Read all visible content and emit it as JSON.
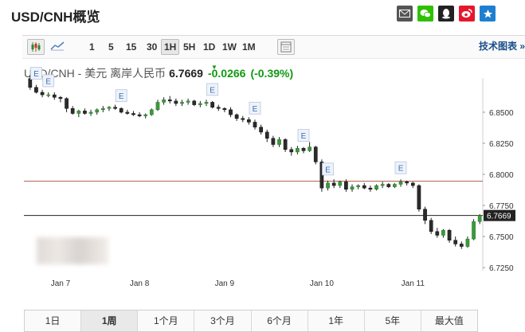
{
  "page": {
    "title": "USD/CNH概览"
  },
  "share_icons": [
    {
      "name": "email-icon",
      "color": "#555555"
    },
    {
      "name": "wechat-icon",
      "color": "#2dc100"
    },
    {
      "name": "qq-icon",
      "color": "#222222"
    },
    {
      "name": "weibo-icon",
      "color": "#e6162d"
    },
    {
      "name": "favorite-icon",
      "color": "#1e7fd1"
    }
  ],
  "toolbar": {
    "intervals": [
      "1",
      "5",
      "15",
      "30",
      "1H",
      "5H",
      "1D",
      "1W",
      "1M"
    ],
    "active_interval": "1H",
    "tech_chart_link": "技术图表 »"
  },
  "quote": {
    "symbol_label": "USD/CNH - 美元 离岸人民币",
    "price": "6.7669",
    "change": "-0.0266",
    "change_pct": "(-0.39%)"
  },
  "chart_data": {
    "type": "candlestick",
    "y_ticks": [
      "6.8500",
      "6.8250",
      "6.8000",
      "6.7750",
      "6.7500",
      "6.7250"
    ],
    "ylim": [
      6.7225,
      6.8775
    ],
    "x_ticks": [
      "Jan 7",
      "Jan 8",
      "Jan 9",
      "Jan 10",
      "Jan 11"
    ],
    "last_price_label": "6.7669",
    "reference_level": 6.7945,
    "event_marker_label": "E",
    "event_markers": [
      1,
      3,
      15,
      30,
      37,
      45,
      49,
      61
    ],
    "candles": [
      [
        6.877,
        6.88,
        6.868,
        6.87
      ],
      [
        6.87,
        6.872,
        6.865,
        6.866
      ],
      [
        6.866,
        6.868,
        6.862,
        6.864
      ],
      [
        6.864,
        6.866,
        6.862,
        6.864
      ],
      [
        6.864,
        6.866,
        6.86,
        6.862
      ],
      [
        6.862,
        6.863,
        6.858,
        6.861
      ],
      [
        6.861,
        6.862,
        6.85,
        6.853
      ],
      [
        6.853,
        6.855,
        6.848,
        6.849
      ],
      [
        6.849,
        6.852,
        6.846,
        6.851
      ],
      [
        6.851,
        6.853,
        6.848,
        6.849
      ],
      [
        6.849,
        6.852,
        6.847,
        6.85
      ],
      [
        6.85,
        6.853,
        6.848,
        6.852
      ],
      [
        6.852,
        6.855,
        6.85,
        6.853
      ],
      [
        6.853,
        6.855,
        6.851,
        6.854
      ],
      [
        6.854,
        6.856,
        6.852,
        6.853
      ],
      [
        6.853,
        6.854,
        6.849,
        6.85
      ],
      [
        6.85,
        6.852,
        6.848,
        6.849
      ],
      [
        6.849,
        6.851,
        6.847,
        6.848
      ],
      [
        6.848,
        6.85,
        6.846,
        6.847
      ],
      [
        6.847,
        6.849,
        6.845,
        6.848
      ],
      [
        6.848,
        6.853,
        6.847,
        6.852
      ],
      [
        6.852,
        6.86,
        6.851,
        6.858
      ],
      [
        6.858,
        6.862,
        6.856,
        6.86
      ],
      [
        6.86,
        6.863,
        6.857,
        6.859
      ],
      [
        6.859,
        6.861,
        6.855,
        6.857
      ],
      [
        6.857,
        6.86,
        6.855,
        6.858
      ],
      [
        6.858,
        6.861,
        6.856,
        6.859
      ],
      [
        6.859,
        6.86,
        6.855,
        6.856
      ],
      [
        6.856,
        6.859,
        6.854,
        6.857
      ],
      [
        6.857,
        6.86,
        6.855,
        6.858
      ],
      [
        6.858,
        6.859,
        6.853,
        6.854
      ],
      [
        6.854,
        6.856,
        6.851,
        6.853
      ],
      [
        6.853,
        6.854,
        6.85,
        6.852
      ],
      [
        6.852,
        6.854,
        6.846,
        6.848
      ],
      [
        6.848,
        6.849,
        6.843,
        6.845
      ],
      [
        6.845,
        6.847,
        6.842,
        6.844
      ],
      [
        6.844,
        6.846,
        6.84,
        6.842
      ],
      [
        6.842,
        6.844,
        6.836,
        6.838
      ],
      [
        6.838,
        6.84,
        6.832,
        6.834
      ],
      [
        6.834,
        6.836,
        6.826,
        6.829
      ],
      [
        6.829,
        6.831,
        6.822,
        6.824
      ],
      [
        6.824,
        6.83,
        6.822,
        6.828
      ],
      [
        6.828,
        6.829,
        6.818,
        6.82
      ],
      [
        6.82,
        6.822,
        6.815,
        6.818
      ],
      [
        6.818,
        6.823,
        6.816,
        6.821
      ],
      [
        6.821,
        6.822,
        6.817,
        6.819
      ],
      [
        6.819,
        6.826,
        6.818,
        6.822
      ],
      [
        6.822,
        6.823,
        6.808,
        6.81
      ],
      [
        6.81,
        6.812,
        6.786,
        6.789
      ],
      [
        6.789,
        6.795,
        6.787,
        6.793
      ],
      [
        6.793,
        6.796,
        6.789,
        6.791
      ],
      [
        6.791,
        6.795,
        6.789,
        6.794
      ],
      [
        6.794,
        6.796,
        6.786,
        6.788
      ],
      [
        6.788,
        6.792,
        6.786,
        6.79
      ],
      [
        6.79,
        6.792,
        6.788,
        6.791
      ],
      [
        6.791,
        6.793,
        6.788,
        6.789
      ],
      [
        6.789,
        6.791,
        6.786,
        6.788
      ],
      [
        6.788,
        6.792,
        6.787,
        6.791
      ],
      [
        6.791,
        6.794,
        6.789,
        6.792
      ],
      [
        6.792,
        6.793,
        6.789,
        6.79
      ],
      [
        6.79,
        6.793,
        6.789,
        6.792
      ],
      [
        6.792,
        6.796,
        6.79,
        6.794
      ],
      [
        6.794,
        6.795,
        6.791,
        6.793
      ],
      [
        6.793,
        6.794,
        6.789,
        6.791
      ],
      [
        6.791,
        6.792,
        6.77,
        6.772
      ],
      [
        6.772,
        6.774,
        6.76,
        6.763
      ],
      [
        6.763,
        6.765,
        6.752,
        6.754
      ],
      [
        6.754,
        6.757,
        6.749,
        6.751
      ],
      [
        6.751,
        6.756,
        6.749,
        6.755
      ],
      [
        6.755,
        6.756,
        6.745,
        6.747
      ],
      [
        6.747,
        6.75,
        6.742,
        6.744
      ],
      [
        6.744,
        6.746,
        6.74,
        6.742
      ],
      [
        6.742,
        6.75,
        6.741,
        6.748
      ],
      [
        6.748,
        6.764,
        6.747,
        6.762
      ],
      [
        6.762,
        6.768,
        6.76,
        6.7669
      ]
    ]
  },
  "ranges": [
    "1日",
    "1周",
    "1个月",
    "3个月",
    "6个月",
    "1年",
    "5年",
    "最大值"
  ],
  "active_range": "1周"
}
